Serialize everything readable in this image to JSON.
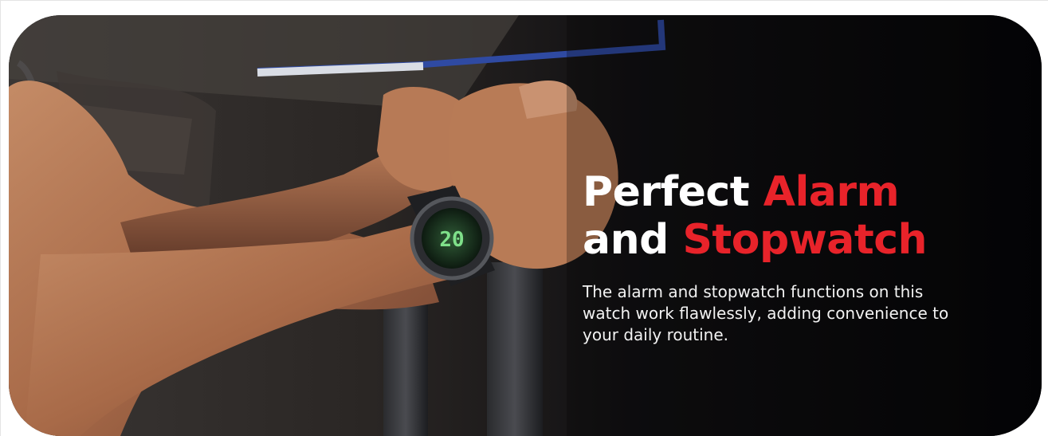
{
  "banner": {
    "headline": {
      "line1_white": "Perfect",
      "line1_red": "Alarm",
      "line2_white": "and",
      "line2_red": "Stopwatch"
    },
    "body": "The alarm and stopwatch functions on this watch work flawlessly, adding convenience to your daily routine.",
    "watch_display": "20",
    "colors": {
      "accent": "#e8232a",
      "background": "#0b0b0d",
      "text": "#ffffff"
    }
  }
}
